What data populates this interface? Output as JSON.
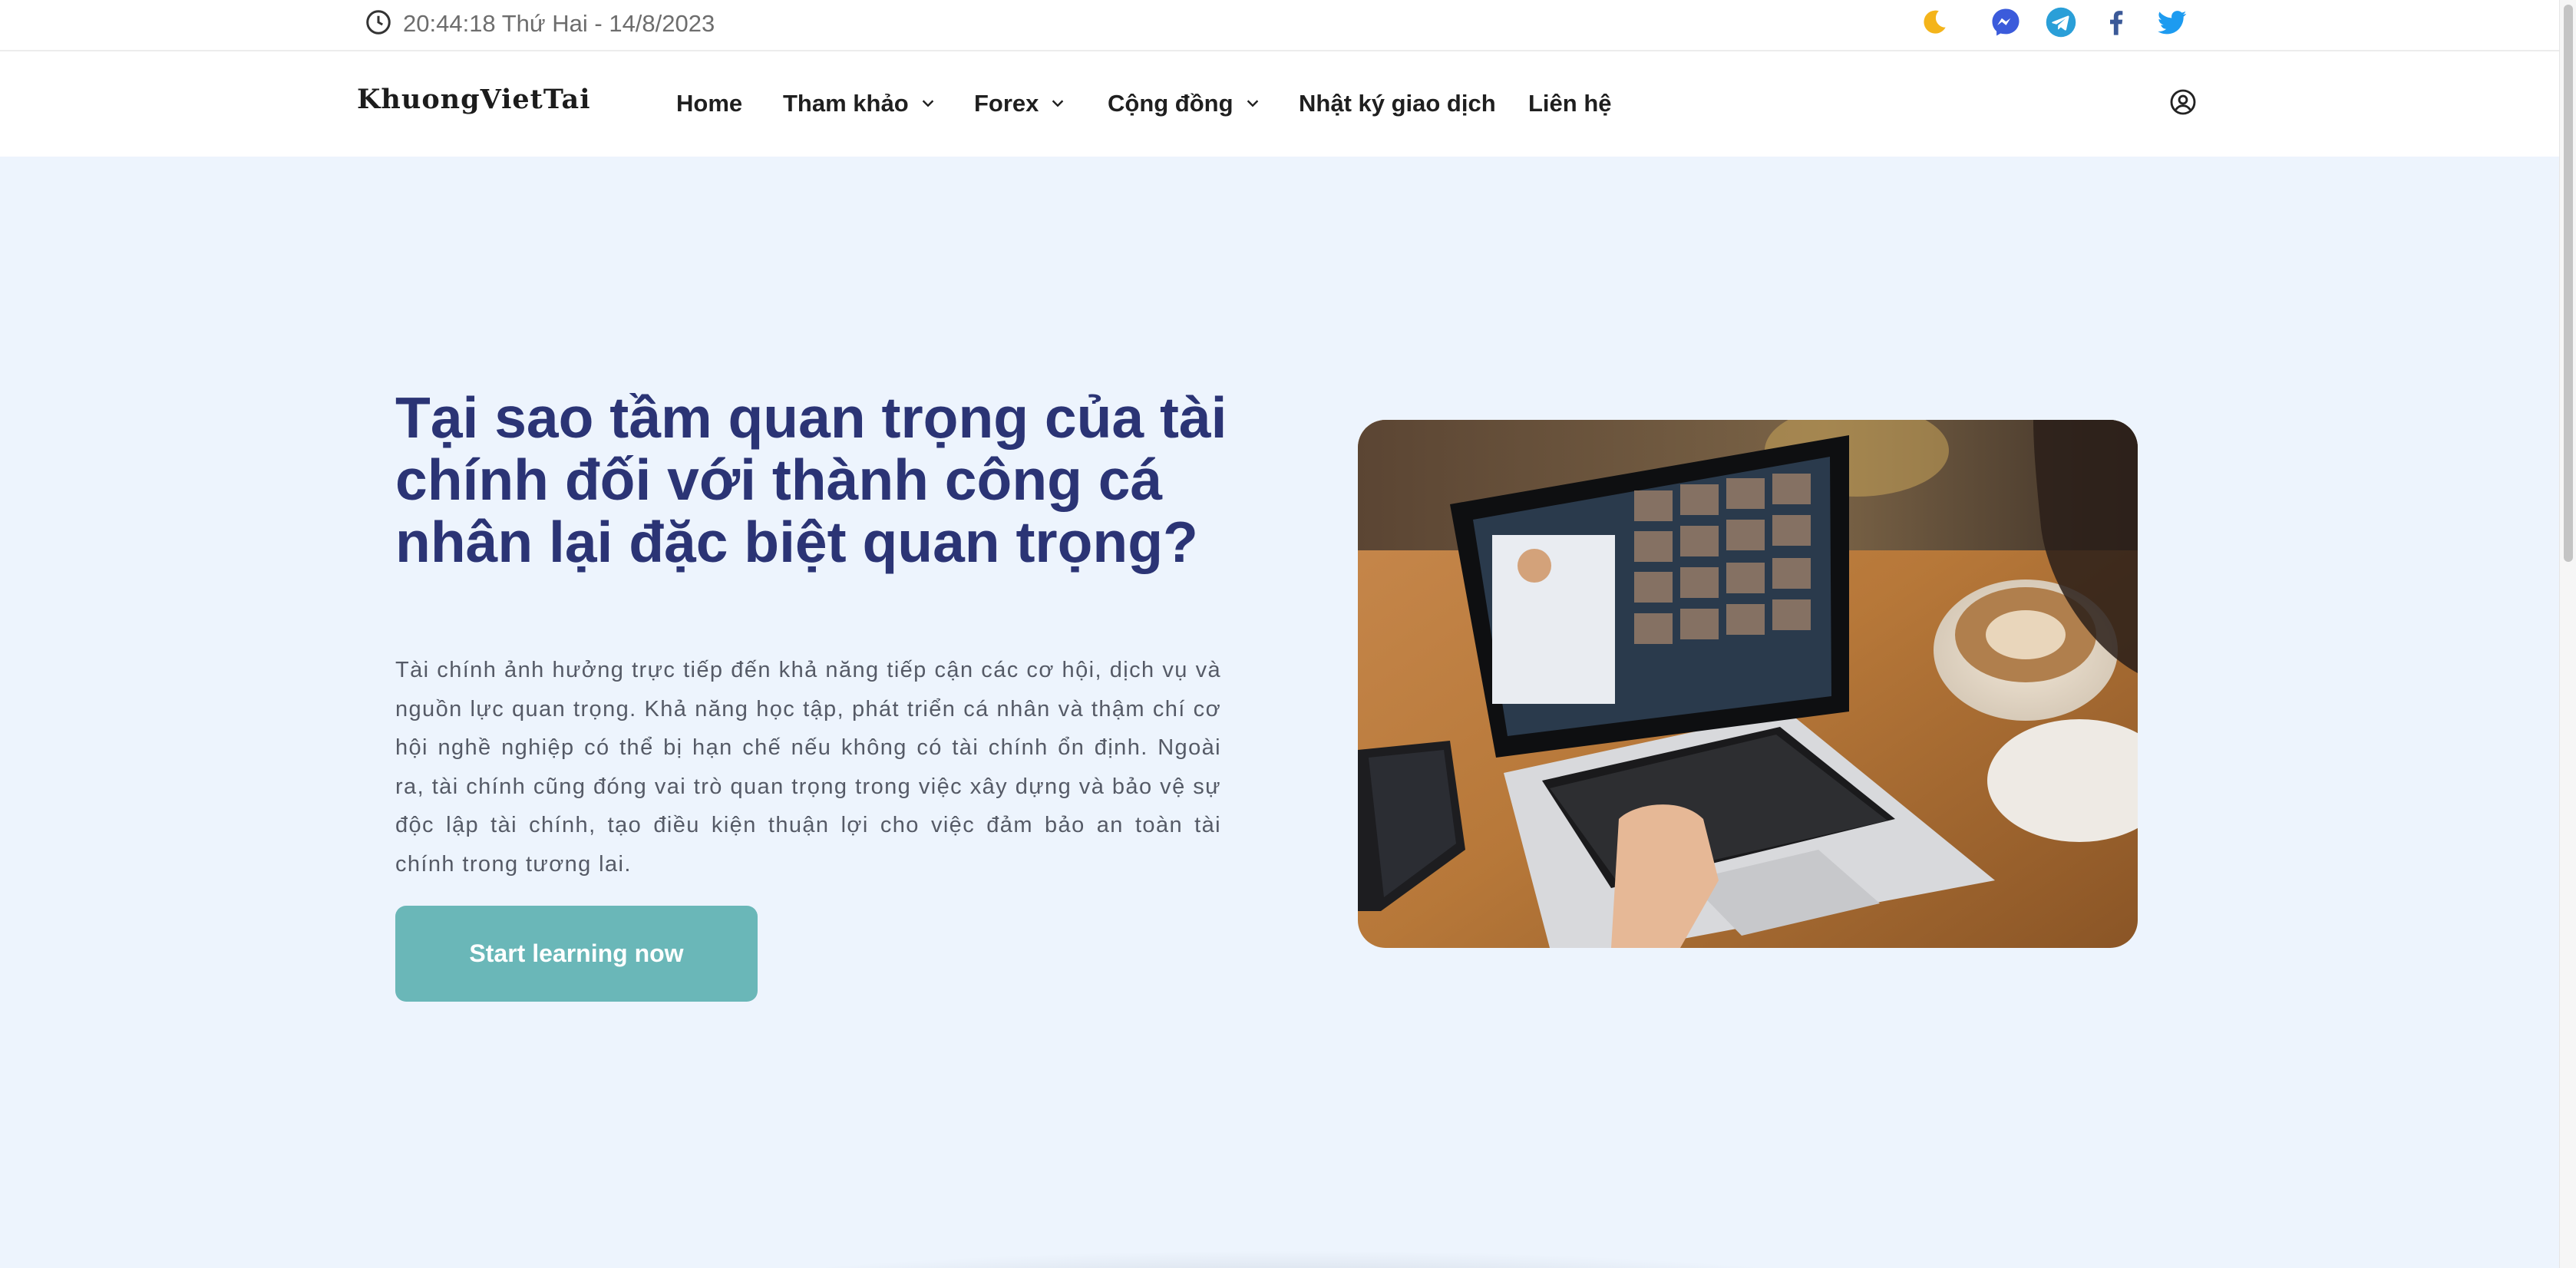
{
  "topbar": {
    "datetime": "20:44:18 Thứ Hai - 14/8/2023",
    "clock_icon": "clock-icon",
    "theme_icon": "moon-icon",
    "social": [
      "messenger-icon",
      "telegram-icon",
      "facebook-icon",
      "twitter-icon"
    ]
  },
  "nav": {
    "logo": "KhuongVietTai",
    "items": [
      {
        "label": "Home",
        "has_dropdown": false
      },
      {
        "label": "Tham khảo",
        "has_dropdown": true
      },
      {
        "label": "Forex",
        "has_dropdown": true
      },
      {
        "label": "Cộng đồng",
        "has_dropdown": true
      },
      {
        "label": "Nhật ký giao dịch",
        "has_dropdown": false
      },
      {
        "label": "Liên hệ",
        "has_dropdown": false
      }
    ],
    "account_icon": "user-account-icon"
  },
  "hero": {
    "title": "Tại sao tầm quan trọng của tài chính đối với thành công cá nhân lại đặc biệt quan trọng?",
    "body": "Tài chính ảnh hưởng trực tiếp đến khả năng tiếp cận các cơ hội, dịch vụ và nguồn lực quan trọng. Khả năng học tập, phát triển cá nhân và thậm chí cơ hội nghề nghiệp có thể bị hạn chế nếu không có tài chính ổn định. Ngoài ra, tài chính cũng đóng vai trò quan trọng trong việc xây dựng và bảo vệ sự độc lập tài chính, tạo điều kiện thuận lợi cho việc đảm bảo an toàn tài chính trong tương lai.",
    "cta_label": "Start learning now"
  },
  "colors": {
    "hero_bg": "#edf4fd",
    "title": "#2b3475",
    "cta": "#6ab7b8",
    "messenger": "#3b5bdb",
    "telegram": "#2a9fd8",
    "facebook": "#3b5998",
    "twitter": "#1d9bf0"
  }
}
